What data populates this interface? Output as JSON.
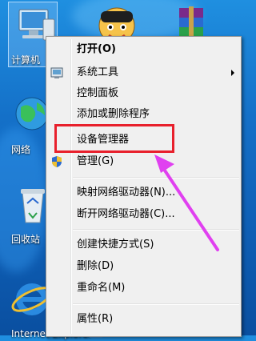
{
  "desktop": {
    "icons": [
      {
        "id": "computer",
        "label": "计算机"
      },
      {
        "id": "network",
        "label": "网络"
      },
      {
        "id": "recycle",
        "label": "回收站"
      },
      {
        "id": "ie",
        "label": "Internet Explorer"
      }
    ]
  },
  "menu": {
    "items": [
      {
        "label": "打开(O)"
      },
      {
        "label": "系统工具"
      },
      {
        "label": "控制面板"
      },
      {
        "label": "添加或删除程序"
      },
      {
        "label": "设备管理器"
      },
      {
        "label": "管理(G)"
      },
      {
        "label": "映射网络驱动器(N)..."
      },
      {
        "label": "断开网络驱动器(C)..."
      },
      {
        "label": "创建快捷方式(S)"
      },
      {
        "label": "删除(D)"
      },
      {
        "label": "重命名(M)"
      },
      {
        "label": "属性(R)"
      }
    ]
  },
  "colors": {
    "highlight_border": "#e8202c",
    "arrow": "#e040f0",
    "desktop": "#1470c8"
  }
}
